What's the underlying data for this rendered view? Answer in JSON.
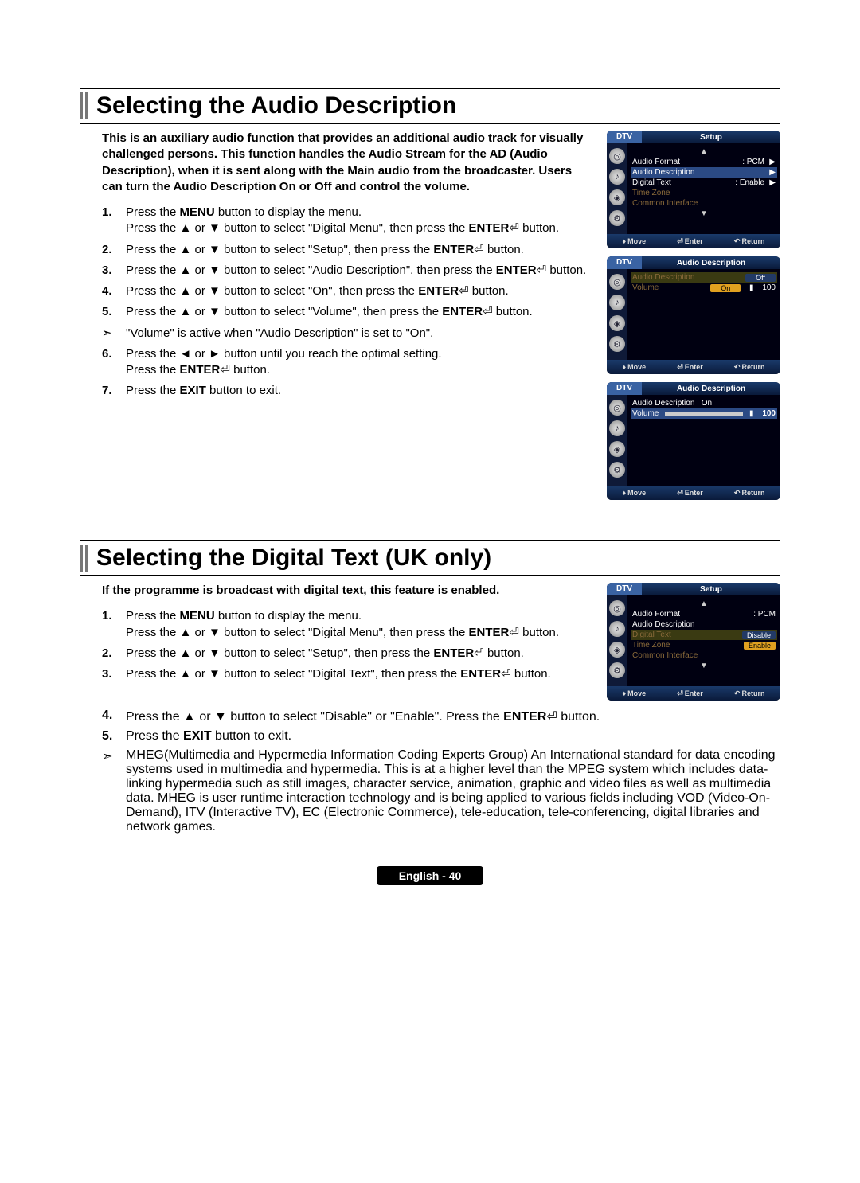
{
  "page_label_lang": "English",
  "page_label_num": "40",
  "section1": {
    "title": "Selecting the Audio Description",
    "intro": "This is an auxiliary audio function that provides an additional audio track for visually challenged persons. This function handles the Audio Stream for the AD (Audio Description), when it is sent along with the Main audio from the broadcaster. Users can turn the Audio Description On or Off and control the volume.",
    "steps": {
      "s1a": "Press the ",
      "s1b": "MENU",
      "s1c": " button to display the menu.",
      "s1d": "Press the ▲ or ▼ button to select \"Digital Menu\", then press the ",
      "s1e": "ENTER",
      "s1f": " button.",
      "s2a": "Press the ▲ or ▼ button to select \"Setup\", then press the ",
      "s2b": "ENTER",
      "s2c": " button.",
      "s3a": "Press the ▲ or ▼ button to select \"Audio Description\", then press the ",
      "s3b": "ENTER",
      "s3c": " button.",
      "s4a": "Press the ▲ or ▼ button to select \"On\", then press the ",
      "s4b": "ENTER",
      "s4c": " button.",
      "s5a": "Press the ▲ or ▼ button to select \"Volume\", then press the ",
      "s5b": "ENTER",
      "s5c": " button.",
      "s5note": "\"Volume\" is active when \"Audio Description\" is set to \"On\".",
      "s6a": "Press the ◄ or ► button until you reach the optimal setting.",
      "s6b": "Press the ",
      "s6c": "ENTER",
      "s6d": " button.",
      "s7a": "Press the ",
      "s7b": "EXIT",
      "s7c": " button to exit."
    },
    "osd": {
      "tab": "DTV",
      "setup_title": "Setup",
      "ad_title": "Audio Description",
      "af_label": "Audio Format",
      "af_value": ": PCM",
      "ad_label": "Audio Description",
      "dt_label": "Digital Text",
      "dt_value": ": Enable",
      "tz_label": "Time Zone",
      "ci_label": "Common Interface",
      "ad_on": "Audio Description : On",
      "vol_label": "Volume",
      "chip_off": "Off",
      "chip_on": "On",
      "vol_100": "100",
      "foot_move": "Move",
      "foot_enter": "Enter",
      "foot_return": "Return"
    }
  },
  "section2": {
    "title": "Selecting the Digital Text (UK only)",
    "intro": "If the programme is broadcast with digital text, this feature is enabled.",
    "steps": {
      "s1a": "Press the ",
      "s1b": "MENU",
      "s1c": " button to display the menu.",
      "s1d": "Press the ▲ or ▼ button to select \"Digital Menu\", then press the ",
      "s1e": "ENTER",
      "s1f": " button.",
      "s2a": "Press the ▲ or ▼ button to select \"Setup\", then press the ",
      "s2b": "ENTER",
      "s2c": " button.",
      "s3a": "Press the ▲ or ▼ button to select \"Digital Text\", then press the ",
      "s3b": "ENTER",
      "s3c": " button.",
      "s4a": "Press the ▲ or ▼ button to select \"Disable\" or \"Enable\". Press the ",
      "s4b": "ENTER",
      "s4c": " button.",
      "s5a": "Press the ",
      "s5b": "EXIT",
      "s5c": " button to exit.",
      "note": "MHEG(Multimedia and Hypermedia Information Coding Experts Group) An International standard for data encoding systems used in multimedia and hypermedia. This is at a higher level than the MPEG system which includes data-linking hypermedia such as still images, character service, animation, graphic and video files as well as multimedia data. MHEG is user runtime interaction technology and is being applied to various fields including VOD (Video-On-Demand), ITV (Interactive TV), EC (Electronic Commerce), tele-education, tele-conferencing, digital libraries and network games."
    },
    "osd": {
      "dt_label": "Digital Text",
      "chip_disable": "Disable",
      "chip_enable": "Enable"
    }
  }
}
